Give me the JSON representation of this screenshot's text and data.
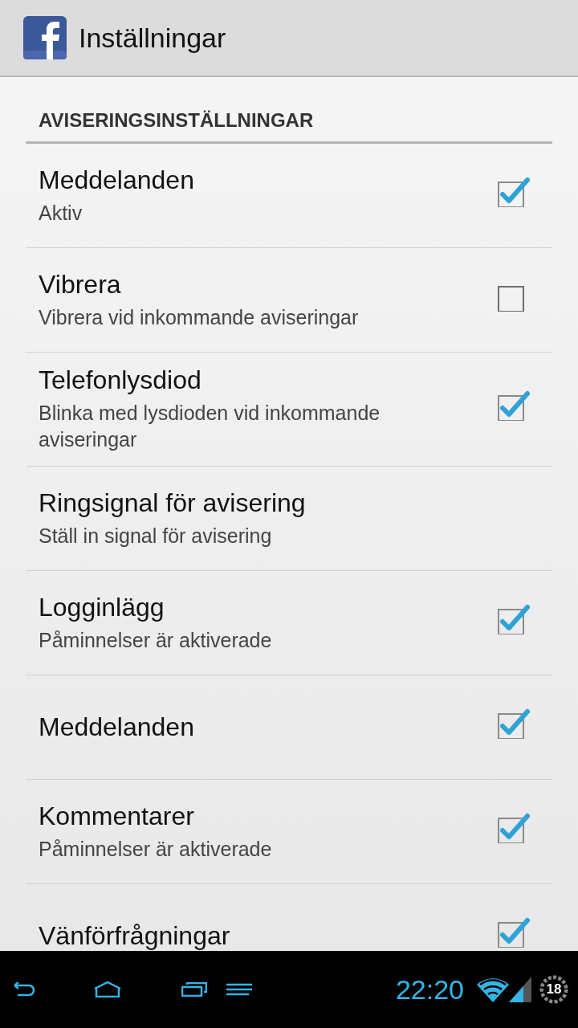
{
  "action_bar": {
    "title": "Inställningar"
  },
  "section": {
    "header": "AVISERINGSINSTÄLLNINGAR"
  },
  "preferences": [
    {
      "kind": "checkbox",
      "title": "Meddelanden",
      "summary": "Aktiv",
      "checked": true
    },
    {
      "kind": "checkbox",
      "title": "Vibrera",
      "summary": "Vibrera vid inkommande aviseringar",
      "checked": false
    },
    {
      "kind": "checkbox",
      "title": "Telefonlysdiod",
      "summary": "Blinka med lysdioden vid inkommande aviseringar",
      "checked": true
    },
    {
      "kind": "link",
      "title": "Ringsignal för avisering",
      "summary": "Ställ in signal för avisering"
    },
    {
      "kind": "checkbox",
      "title": "Logginlägg",
      "summary": "Påminnelser är aktiverade",
      "checked": true
    },
    {
      "kind": "checkbox",
      "title": "Meddelanden",
      "checked": true
    },
    {
      "kind": "checkbox",
      "title": "Kommentarer",
      "summary": "Påminnelser är aktiverade",
      "checked": true
    },
    {
      "kind": "checkbox",
      "title": "Vänförfrågningar",
      "checked": true
    }
  ],
  "nav_bar": {
    "time": "22:20",
    "badge": "18"
  }
}
